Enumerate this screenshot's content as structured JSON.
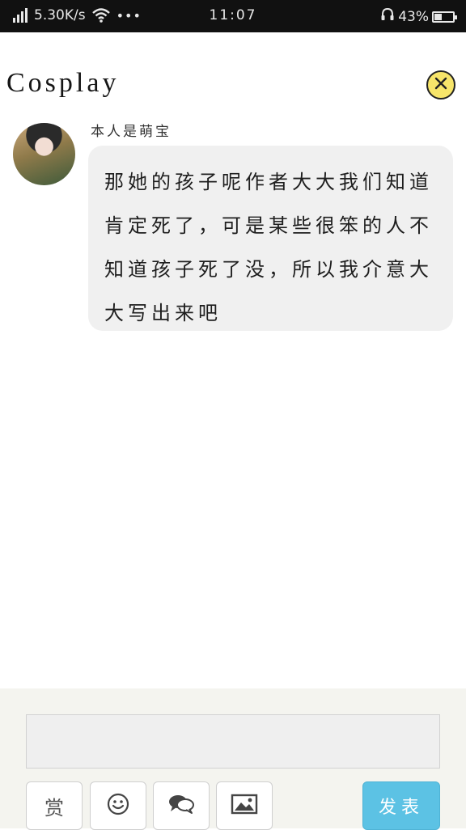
{
  "status_bar": {
    "speed": "5.30K/s",
    "more": "•••",
    "time": "11:07",
    "battery": "43%",
    "battery_level": 0.43
  },
  "header": {
    "title": "Cosplay"
  },
  "comment": {
    "author": "本人是萌宝",
    "text": "那她的孩子呢作者大大我们知道肯定死了，可是某些很笨的人不知道孩子死了没，所以我介意大大写出来吧"
  },
  "composer": {
    "input_value": "",
    "reward_label": "赏",
    "submit_label": "发表"
  },
  "icons": [
    "signal-icon",
    "wifi-icon",
    "headphone-icon",
    "battery-icon",
    "close-icon",
    "emoji-icon",
    "chat-icon",
    "image-icon"
  ],
  "colors": {
    "close_button": "#f7e56a",
    "submit_button": "#5cc2e4",
    "bubble": "#f0f0f0",
    "status_bar": "#111111"
  }
}
